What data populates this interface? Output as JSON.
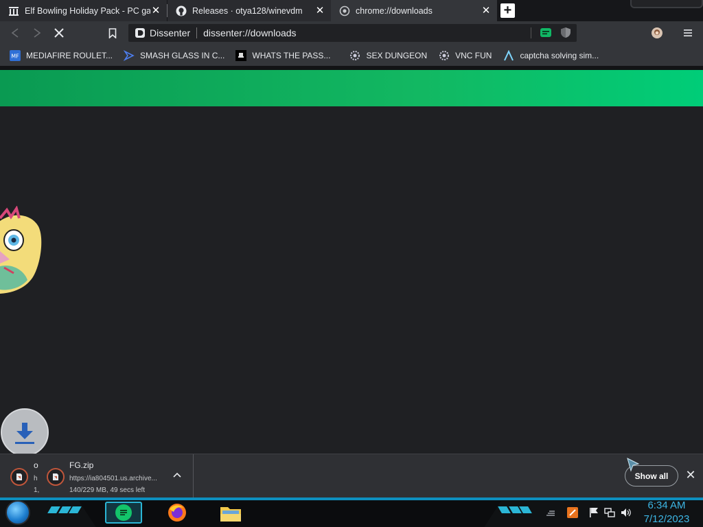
{
  "tabs": [
    {
      "title": "Elf Bowling Holiday Pack - PC gam",
      "favicon": "archive-icon"
    },
    {
      "title": "Releases · otya128/winevdm",
      "favicon": "github-icon"
    },
    {
      "title": "chrome://downloads",
      "favicon": "dissenter-icon"
    }
  ],
  "toolbar": {
    "site_label": "Dissenter",
    "url": "dissenter://downloads"
  },
  "bookmarks": [
    {
      "label": "MEDIAFIRE ROULET...",
      "icon": "mediafire-icon"
    },
    {
      "label": "SMASH GLASS IN C...",
      "icon": "smash-icon"
    },
    {
      "label": "WHATS THE PASS...",
      "icon": "dark-site-icon"
    },
    {
      "label": "SEX DUNGEON",
      "icon": "gear-site-icon"
    },
    {
      "label": "VNC FUN",
      "icon": "gear-site-icon"
    },
    {
      "label": "captcha solving sim...",
      "icon": "lambda-icon"
    }
  ],
  "downloads": {
    "partial": {
      "line1": "o",
      "line2": "h",
      "line3": "1,"
    },
    "main": {
      "filename": "FG.zip",
      "url": "https://ia804501.us.archive...",
      "status": "140/229 MB, 49 secs left"
    },
    "show_all_label": "Show all"
  },
  "taskbar": {
    "time": "6:34 AM",
    "date": "7/12/2023"
  },
  "colors": {
    "banner_start": "#0a9a52",
    "banner_end": "#00cd78",
    "clock": "#3db7e6"
  }
}
